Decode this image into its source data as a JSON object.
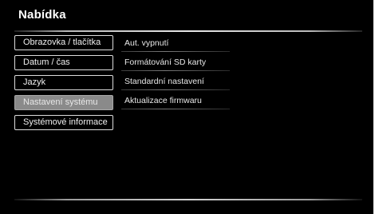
{
  "header": {
    "title": "Nabídka"
  },
  "menu": {
    "items": [
      {
        "label": "Obrazovka / tlačítka"
      },
      {
        "label": "Datum / čas"
      },
      {
        "label": "Jazyk"
      },
      {
        "label": "Nastavení systému",
        "selected": true
      },
      {
        "label": "Systémové informace"
      }
    ]
  },
  "submenu": {
    "items": [
      {
        "label": "Aut. vypnutí"
      },
      {
        "label": "Formátování SD karty"
      },
      {
        "label": "Standardní nastavení"
      },
      {
        "label": "Aktualizace firmwaru"
      }
    ]
  },
  "colors": {
    "background": "#000000",
    "selected": "#8a8a8a",
    "text": "#ffffff"
  }
}
